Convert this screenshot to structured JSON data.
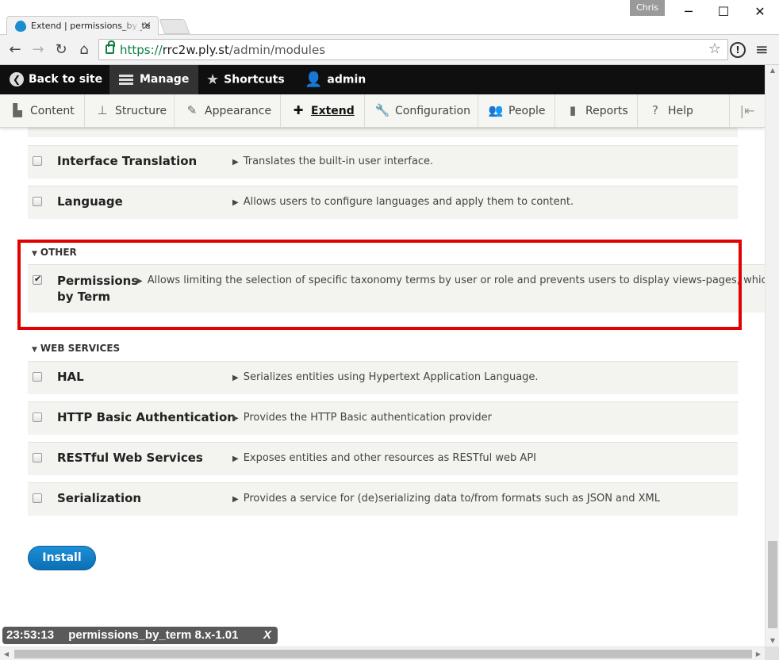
{
  "browser": {
    "tab_title": "Extend | permissions_by_te",
    "tab_close": "×",
    "profile_name": "Chris",
    "window_controls": [
      "─",
      "☐",
      "✕"
    ],
    "url_scheme": "https://",
    "url_host": "rrc2w.ply.st",
    "url_path": "/admin/modules",
    "nav": {
      "back": "back-arrow-icon",
      "forward": "forward-arrow-icon",
      "reload": "reload-icon",
      "home": "home-icon"
    }
  },
  "admin_toolbar": {
    "back_to_site": "Back to site",
    "manage": "Manage",
    "shortcuts": "Shortcuts",
    "user": "admin"
  },
  "tray": {
    "items": [
      {
        "label": "Content",
        "icon": "content-icon"
      },
      {
        "label": "Structure",
        "icon": "structure-icon"
      },
      {
        "label": "Appearance",
        "icon": "appearance-icon"
      },
      {
        "label": "Extend",
        "icon": "extend-icon",
        "active": true
      },
      {
        "label": "Configuration",
        "icon": "configuration-icon"
      },
      {
        "label": "People",
        "icon": "people-icon"
      },
      {
        "label": "Reports",
        "icon": "reports-icon"
      },
      {
        "label": "Help",
        "icon": "help-icon"
      }
    ]
  },
  "modules_top": [
    {
      "name": "Interface Translation",
      "description": "Translates the built-in user interface.",
      "checked": false
    },
    {
      "name": "Language",
      "description": "Allows users to configure languages and apply them to content.",
      "checked": false
    }
  ],
  "group_other": {
    "title": "OTHER",
    "module": {
      "name": "Permissions by Term",
      "description": "Allows limiting the selection of specific taxonomy terms by user or role and prevents users to display views-pages, which l",
      "checked": true
    }
  },
  "group_web_services": {
    "title": "WEB SERVICES",
    "modules": [
      {
        "name": "HAL",
        "description": "Serializes entities using Hypertext Application Language.",
        "checked": false
      },
      {
        "name": "HTTP Basic Authentication",
        "description": "Provides the HTTP Basic authentication provider",
        "checked": false
      },
      {
        "name": "RESTful Web Services",
        "description": "Exposes entities and other resources as RESTful web API",
        "checked": false
      },
      {
        "name": "Serialization",
        "description": "Provides a service for (de)serializing data to/from formats such as JSON and XML",
        "checked": false
      }
    ]
  },
  "install_button": "Install",
  "status_overlay": {
    "time": "23:53:13",
    "message": "permissions_by_term 8.x-1.01",
    "close": "X"
  },
  "colors": {
    "highlight": "#e30000",
    "install_button": "#0b6fb4",
    "admin_bar": "#0f0f0f"
  }
}
